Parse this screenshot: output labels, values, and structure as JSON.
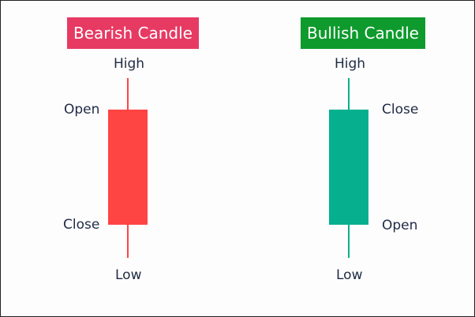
{
  "diagram": {
    "bearish": {
      "title": "Bearish Candle",
      "color": "#ff4444",
      "title_bg": "#e63a63",
      "labels": {
        "high": "High",
        "open": "Open",
        "close": "Close",
        "low": "Low"
      }
    },
    "bullish": {
      "title": "Bullish Candle",
      "color": "#06b08e",
      "title_bg": "#0e9a2c",
      "labels": {
        "high": "High",
        "close": "Close",
        "open": "Open",
        "low": "Low"
      }
    }
  }
}
